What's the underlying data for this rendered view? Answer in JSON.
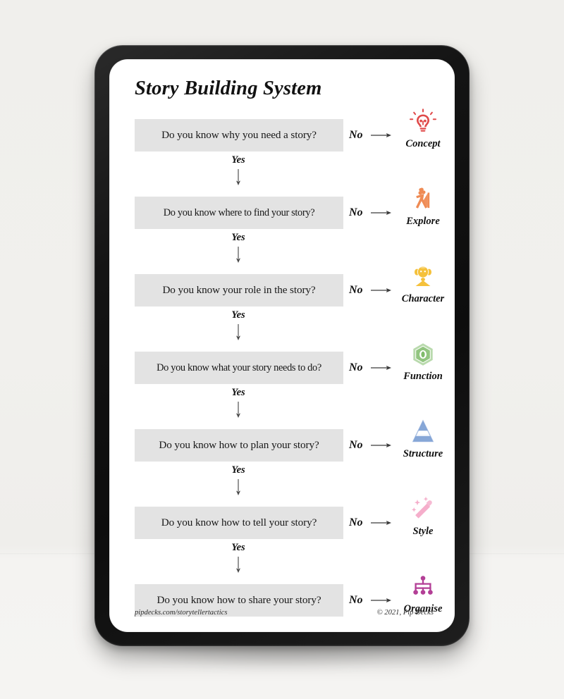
{
  "card": {
    "title": "Story Building System",
    "no_label": "No",
    "yes_label": "Yes"
  },
  "steps": [
    {
      "question": "Do you know why you need a story?",
      "no_label": "No",
      "tactic": "Concept",
      "icon": "lightbulb-icon",
      "color": "#e04a4a"
    },
    {
      "question": "Do you know where to find your story?",
      "no_label": "No",
      "tactic": "Explore",
      "icon": "explorer-flag-icon",
      "color": "#ef8b54"
    },
    {
      "question": "Do you know your role in the story?",
      "no_label": "No",
      "tactic": "Character",
      "icon": "person-icon",
      "color": "#f5c13b"
    },
    {
      "question": "Do you know what your story needs to do?",
      "no_label": "No",
      "tactic": "Function",
      "icon": "hex-nut-icon",
      "color": "#7fbb6a"
    },
    {
      "question": "Do you know how to plan your story?",
      "no_label": "No",
      "tactic": "Structure",
      "icon": "pyramid-icon",
      "color": "#7d9fd4"
    },
    {
      "question": "Do you know how to tell your story?",
      "no_label": "No",
      "tactic": "Style",
      "icon": "magic-wand-icon",
      "color": "#f5aecb"
    },
    {
      "question": "Do you know how to share your story?",
      "no_label": "No",
      "tactic": "Organise",
      "icon": "hierarchy-tree-icon",
      "color": "#b33f96"
    }
  ],
  "connectors": [
    {
      "label": "Yes"
    },
    {
      "label": "Yes"
    },
    {
      "label": "Yes"
    },
    {
      "label": "Yes"
    },
    {
      "label": "Yes"
    },
    {
      "label": "Yes"
    }
  ],
  "footer": {
    "url": "pipdecks.com/storytellertactics",
    "copyright": "© 2021, Pip Decks"
  },
  "theme": {
    "box_fill": "#e3e3e3",
    "text": "#181818",
    "device_frame": "#141414",
    "screen": "#ffffff",
    "backdrop": "#f1f0ed"
  }
}
